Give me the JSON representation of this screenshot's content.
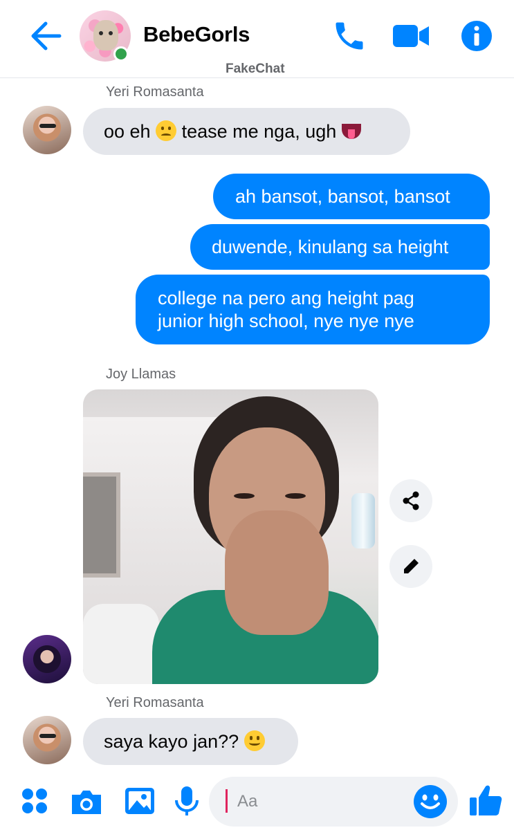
{
  "header": {
    "title": "BebeGorls",
    "watermark": "FakeChat",
    "icons": [
      "back-arrow-icon",
      "group-avatar",
      "online-indicator",
      "phone-icon",
      "video-camera-icon",
      "info-icon"
    ]
  },
  "messages": {
    "m1": {
      "sender": "Yeri Romasanta",
      "text_before": "oo eh",
      "text_middle": "tease me nga, ugh"
    },
    "m2": {
      "text": "ah bansot, bansot, bansot"
    },
    "m3": {
      "text": "duwende, kinulang sa height"
    },
    "m4": {
      "line1": "college na pero ang height pag",
      "line2": "junior high school, nye nye nye"
    },
    "m5": {
      "sender": "Joy Llamas"
    },
    "m6": {
      "sender": "Yeri Romasanta",
      "text": "saya kayo jan??"
    }
  },
  "composer": {
    "placeholder": "Aa",
    "icons": [
      "apps-grid-icon",
      "camera-icon",
      "gallery-icon",
      "microphone-icon",
      "emoji-icon",
      "thumbs-up-icon"
    ]
  },
  "colors": {
    "accent": "#0084ff",
    "incoming_bubble": "#e4e6eb",
    "online": "#31a24c"
  }
}
